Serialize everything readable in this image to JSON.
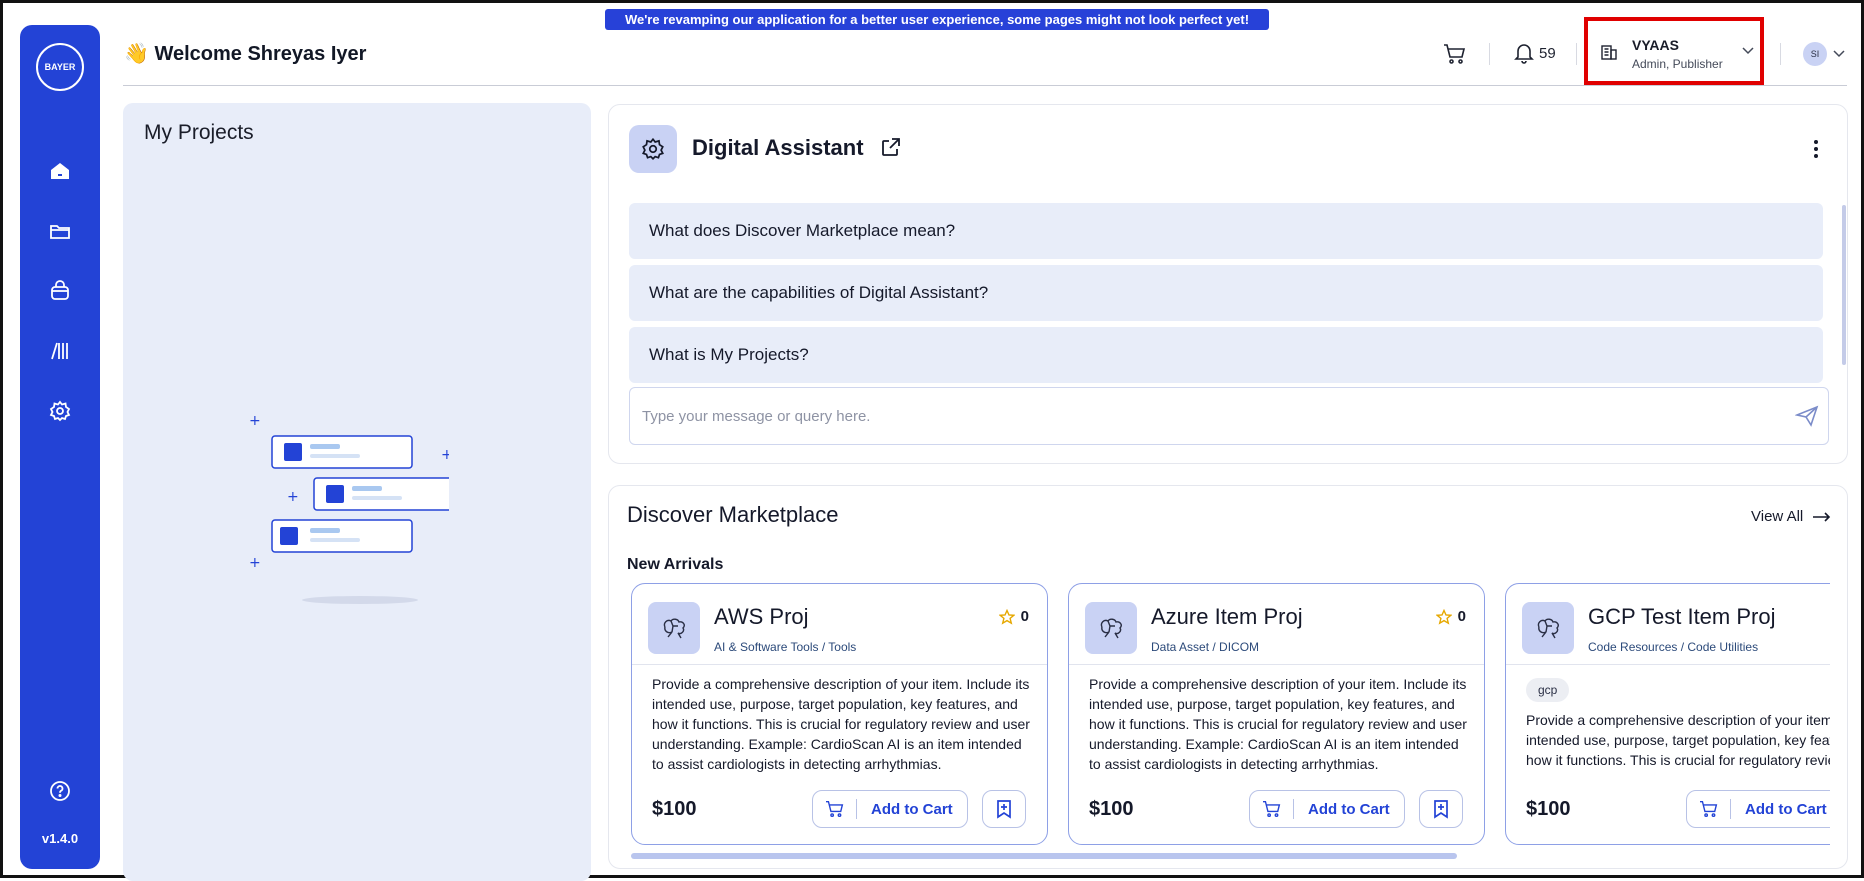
{
  "banner": "We're revamping our application for a better user experience, some pages might not look perfect yet!",
  "sidebar": {
    "logo_text": "BAYER",
    "logo_vertical": "BAYER",
    "version": "v1.4.0"
  },
  "header": {
    "welcome": "👋 Welcome Shreyas Iyer",
    "notification_count": "59",
    "org_name": "VYAAS",
    "org_role": "Admin, Publisher",
    "avatar_initials": "SI"
  },
  "projects": {
    "title": "My Projects"
  },
  "assistant": {
    "title": "Digital Assistant",
    "questions": [
      "What does Discover Marketplace mean?",
      "What are the capabilities of Digital Assistant?",
      "What is My Projects?"
    ],
    "input_placeholder": "Type your message or query here."
  },
  "marketplace": {
    "title": "Discover Marketplace",
    "view_all": "View All",
    "section": "New Arrivals",
    "add_to_cart_label": "Add to Cart",
    "cards": [
      {
        "title": "AWS Proj",
        "category": "AI & Software Tools / Tools",
        "rating": "0",
        "description": "Provide a comprehensive description of your item. Include its intended use, purpose, target population, key features, and how it functions. This is crucial for regulatory review and user understanding. Example: CardioScan AI is an item intended to assist cardiologists in detecting arrhythmias.",
        "price": "$100"
      },
      {
        "title": "Azure Item Proj",
        "category": "Data Asset / DICOM",
        "rating": "0",
        "description": "Provide a comprehensive description of your item. Include its intended use, purpose, target population, key features, and how it functions. This is crucial for regulatory review and user understanding. Example: CardioScan AI is an item intended to assist cardiologists in detecting arrhythmias.",
        "price": "$100"
      },
      {
        "title": "GCP Test Item Proj",
        "category": "Code Resources / Code Utilities",
        "tag": "gcp",
        "description": "Provide a comprehensive description of your item. Include its intended use, purpose, target population, key features, and how it functions. This is crucial for regulatory review and user understanding.",
        "price": "$100"
      }
    ]
  },
  "colors": {
    "primary": "#2343d6",
    "panel_bg": "#e8edf9",
    "highlight_box": "#e00000"
  }
}
